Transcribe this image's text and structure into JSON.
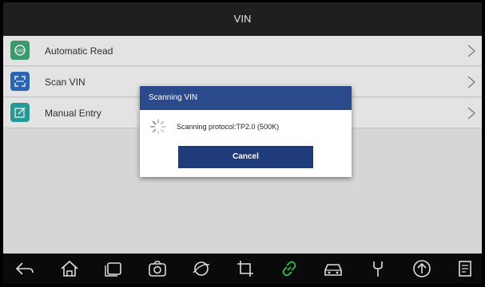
{
  "header": {
    "title": "VIN"
  },
  "menu": [
    {
      "label": "Automatic Read",
      "icon": "auto-read-icon",
      "color": "#3fa877"
    },
    {
      "label": "Scan VIN",
      "icon": "scan-frame-icon",
      "color": "#2e6ec3"
    },
    {
      "label": "Manual Entry",
      "icon": "edit-icon",
      "color": "#2aa7a3"
    }
  ],
  "dialog": {
    "title": "Scanning VIN",
    "message": "Scanning protocol:TP2.0 (500K)",
    "cancel_label": "Cancel"
  },
  "colors": {
    "dialog_header": "#2b4a8c",
    "cancel_button": "#1f3b7a",
    "highlight_icon": "#33c24a"
  },
  "navbar": {
    "icons": [
      "back-icon",
      "home-icon",
      "recent-apps-icon",
      "camera-icon",
      "browser-icon",
      "crop-icon",
      "link-icon",
      "car-icon",
      "wrench-icon",
      "upload-icon",
      "document-icon"
    ]
  }
}
